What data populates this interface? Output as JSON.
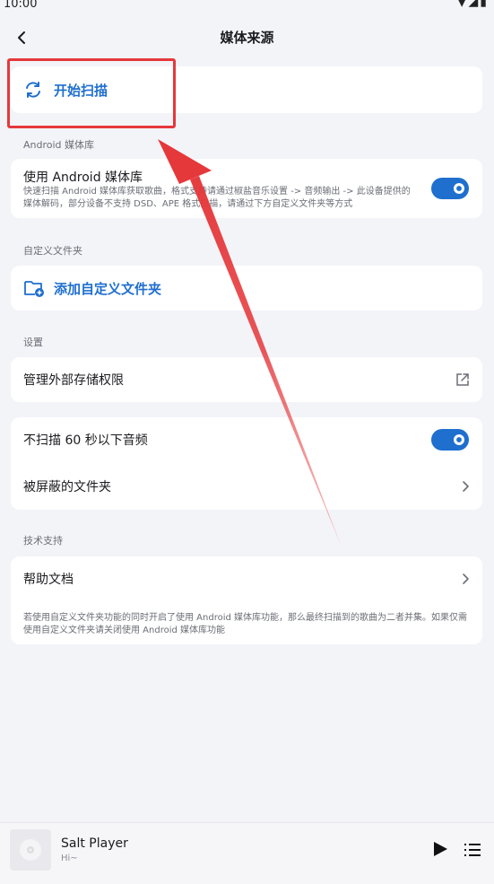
{
  "status_bar": {
    "time": "10:00"
  },
  "header": {
    "title": "媒体来源"
  },
  "scan": {
    "label": "开始扫描"
  },
  "android_section": {
    "label": "Android 媒体库",
    "title": "使用 Android 媒体库",
    "description": "快速扫描 Android 媒体库获取歌曲，格式支持请通过椒盐音乐设置 -> 音频输出 -> 此设备提供的媒体解码，部分设备不支持 DSD、APE 格式扫描，请通过下方自定义文件夹等方式",
    "enabled": true
  },
  "custom_folder_section": {
    "label": "自定义文件夹",
    "add_label": "添加自定义文件夹"
  },
  "settings_section": {
    "label": "设置",
    "storage_permission": "管理外部存储权限",
    "skip_short_audio": "不扫描 60 秒以下音频",
    "skip_short_audio_enabled": true,
    "blocked_folders": "被屏蔽的文件夹"
  },
  "support_section": {
    "label": "技术支持",
    "help_docs": "帮助文档",
    "note": "若使用自定义文件夹功能的同时开启了使用 Android 媒体库功能，那么最终扫描到的歌曲为二者并集。如果仅需使用自定义文件夹请关闭使用 Android 媒体库功能"
  },
  "player": {
    "title": "Salt Player",
    "subtitle": "Hi~"
  },
  "colors": {
    "accent": "#1f6fcf",
    "annotation": "#e5383b",
    "background": "#f3f4f8"
  }
}
